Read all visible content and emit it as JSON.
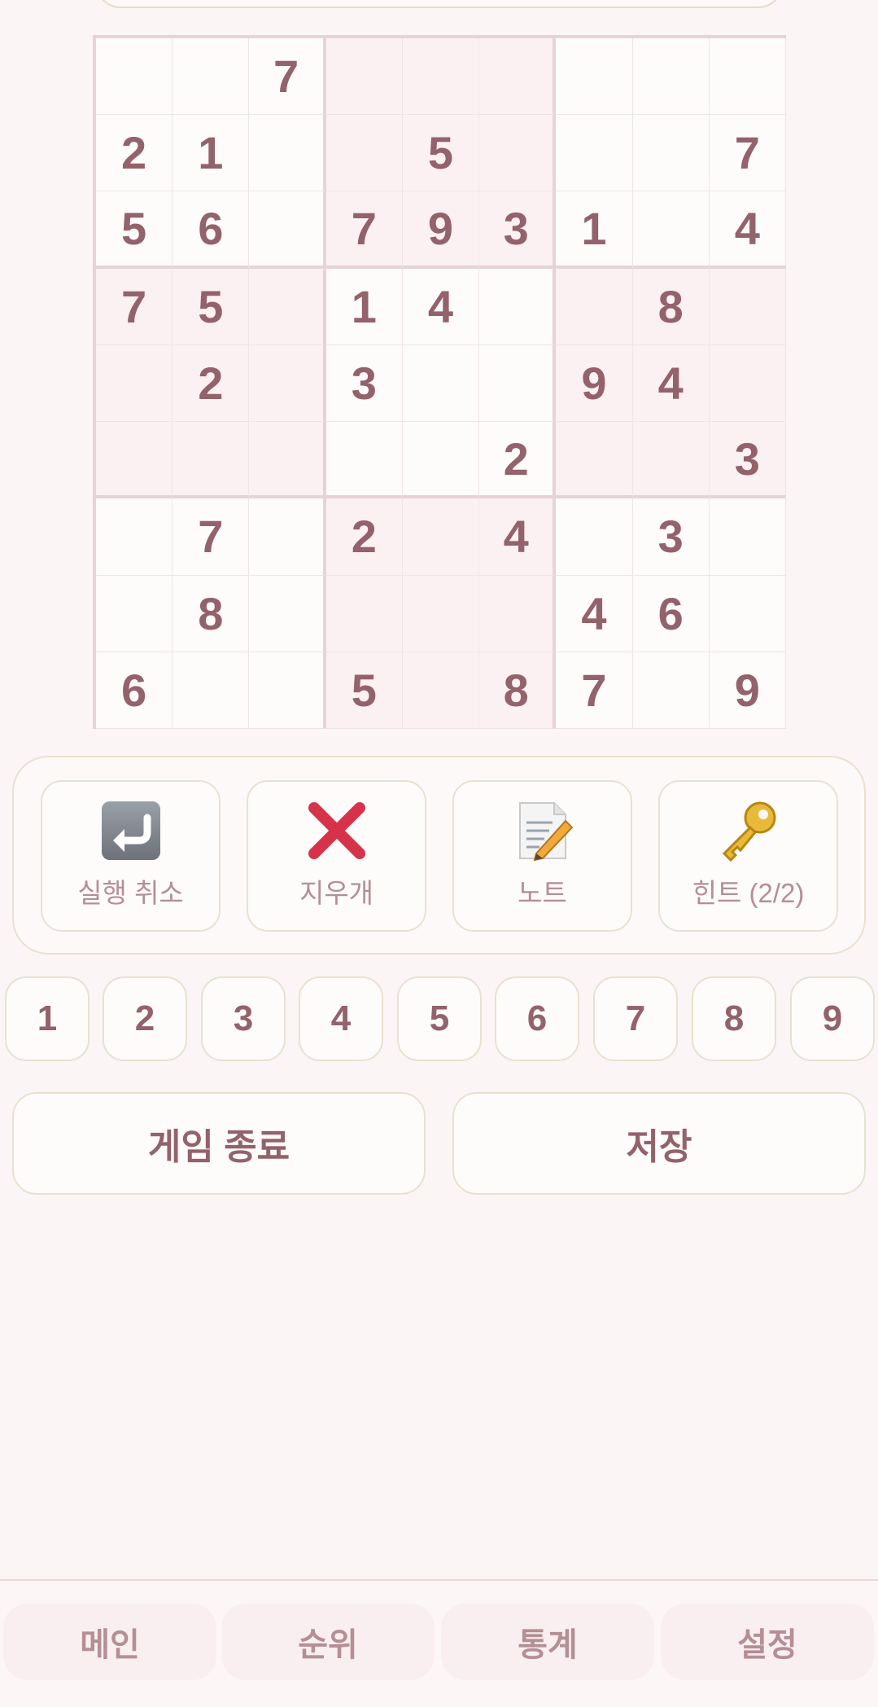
{
  "board": {
    "cells": [
      [
        "",
        "",
        "7",
        "",
        "",
        "",
        "",
        "",
        ""
      ],
      [
        "2",
        "1",
        "",
        "",
        "5",
        "",
        "",
        "",
        "7"
      ],
      [
        "5",
        "6",
        "",
        "7",
        "9",
        "3",
        "1",
        "",
        "4"
      ],
      [
        "7",
        "5",
        "",
        "1",
        "4",
        "",
        "",
        "8",
        ""
      ],
      [
        "",
        "2",
        "",
        "3",
        "",
        "",
        "9",
        "4",
        ""
      ],
      [
        "",
        "",
        "",
        "",
        "",
        "2",
        "",
        "",
        "3"
      ],
      [
        "",
        "7",
        "",
        "2",
        "",
        "4",
        "",
        "3",
        ""
      ],
      [
        "",
        "8",
        "",
        "",
        "",
        "",
        "4",
        "6",
        ""
      ],
      [
        "6",
        "",
        "",
        "5",
        "",
        "8",
        "7",
        "",
        "9"
      ]
    ]
  },
  "tools": {
    "undo_label": "실행 취소",
    "erase_label": "지우개",
    "note_label": "노트",
    "hint_label": "힌트 (2/2)",
    "undo_icon": "undo-arrow-icon",
    "erase_icon": "red-x-icon",
    "note_icon": "memo-pencil-icon",
    "hint_icon": "key-icon"
  },
  "numpad": [
    "1",
    "2",
    "3",
    "4",
    "5",
    "6",
    "7",
    "8",
    "9"
  ],
  "actions": {
    "end_game_label": "게임 종료",
    "save_label": "저장"
  },
  "nav": {
    "main_label": "메인",
    "ranking_label": "순위",
    "stats_label": "통계",
    "settings_label": "설정"
  },
  "colors": {
    "background": "#fbf5f6",
    "digit": "#93626a",
    "highlight": "#fbf0f2",
    "border": "#e9e1cf"
  }
}
